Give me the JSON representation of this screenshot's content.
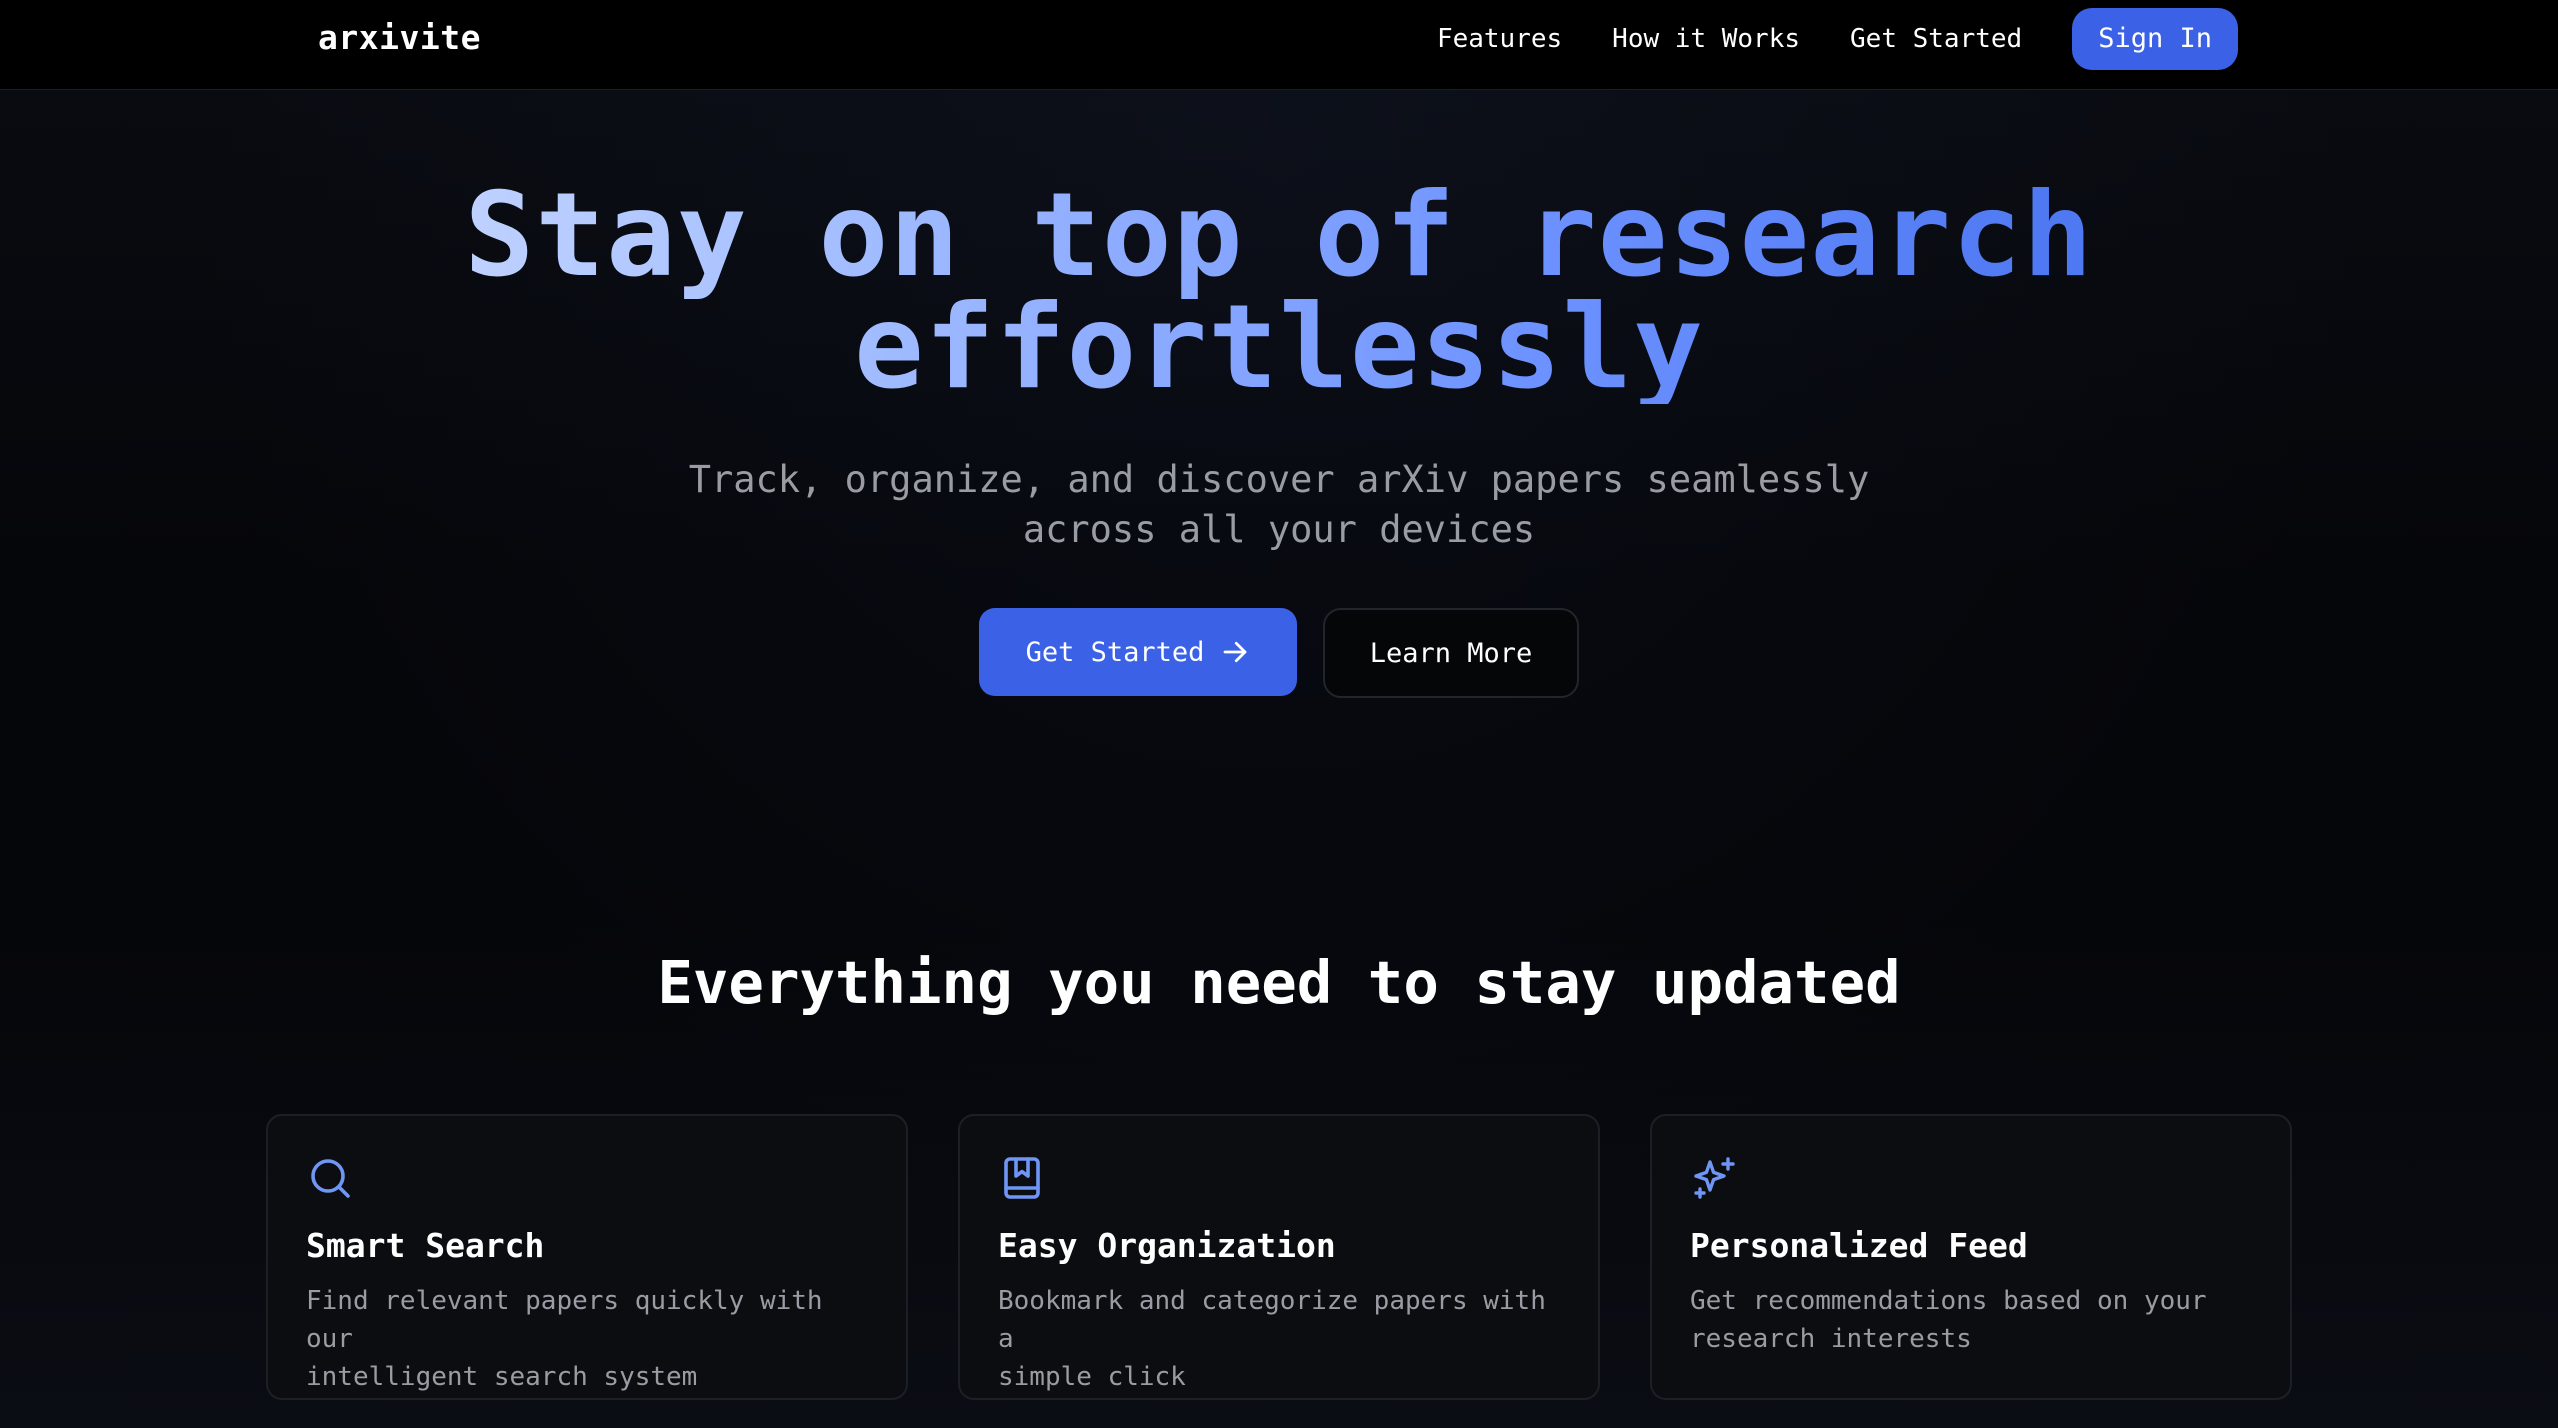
{
  "nav": {
    "logo": "arxivite",
    "links": [
      "Features",
      "How it Works",
      "Get Started"
    ],
    "signin_label": "Sign In"
  },
  "hero": {
    "title_line1": "Stay on top of research",
    "title_line2": "effortlessly",
    "subtitle_line1": "Track, organize, and discover arXiv papers seamlessly",
    "subtitle_line2": "across all your devices",
    "primary_cta": "Get Started",
    "secondary_cta": "Learn More"
  },
  "features": {
    "title": "Everything you need to stay updated",
    "cards": [
      {
        "icon": "search-icon",
        "title": "Smart Search",
        "desc_line1": "Find relevant papers quickly with our",
        "desc_line2": "intelligent search system"
      },
      {
        "icon": "bookmark-book-icon",
        "title": "Easy Organization",
        "desc_line1": "Bookmark and categorize papers with a",
        "desc_line2": "simple click"
      },
      {
        "icon": "sparkles-icon",
        "title": "Personalized Feed",
        "desc_line1": "Get recommendations based on your",
        "desc_line2": "research interests"
      }
    ]
  },
  "colors": {
    "accent": "#3b62e6",
    "icon": "#6f95f5",
    "muted_text": "#9a9ca4",
    "background": "#05060a"
  }
}
